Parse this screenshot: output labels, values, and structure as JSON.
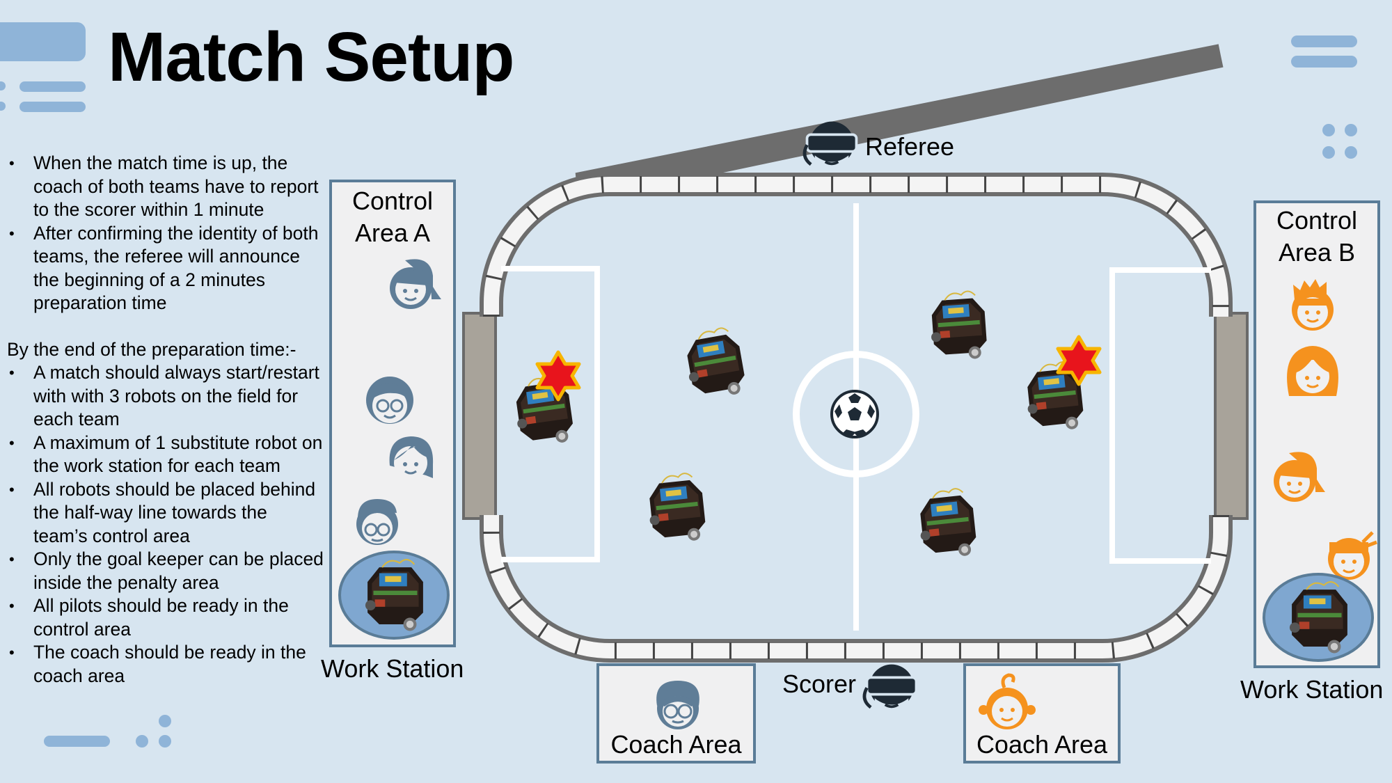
{
  "title": "Match Setup",
  "rules": {
    "bullets_1": [
      "When the match time is up, the coach of both teams have to report to the scorer within 1 minute",
      "After confirming the identity of both teams, the referee will announce the beginning of a 2 minutes preparation time"
    ],
    "subheading": "By the end of the preparation time:-",
    "bullets_2": [
      "A match should always start/restart with with 3 robots on the field for each team",
      "A maximum of 1 substitute robot on the work station for each team",
      "All robots should be placed behind the half-way line towards the team’s control area",
      "Only the goal keeper can be placed inside the penalty area",
      "All pilots should be ready in the control area",
      "The coach should be ready in the coach area"
    ]
  },
  "labels": {
    "referee": "Referee",
    "scorer": "Scorer",
    "control_area_a": "Control Area A",
    "control_area_b": "Control Area B",
    "work_station_a": "Work Station",
    "work_station_b": "Work Station",
    "coach_area_a": "Coach Area",
    "coach_area_b": "Coach Area"
  },
  "icons": {
    "referee": "vr-headset-person-icon",
    "scorer": "vr-headset-person-icon",
    "ball": "soccer-ball-icon",
    "goalkeeper_marker": "red-star-icon",
    "team_a_person": "person-icon",
    "team_b_person": "person-icon"
  },
  "colors": {
    "background": "#d7e5f0",
    "team_a": "#5f7d97",
    "team_b": "#f5921e",
    "panel_border": "#5a7c97",
    "decor": "#8fb4d8",
    "star": "#e8141c",
    "star_outline": "#f7b500",
    "dark_icon": "#1e2a35"
  }
}
